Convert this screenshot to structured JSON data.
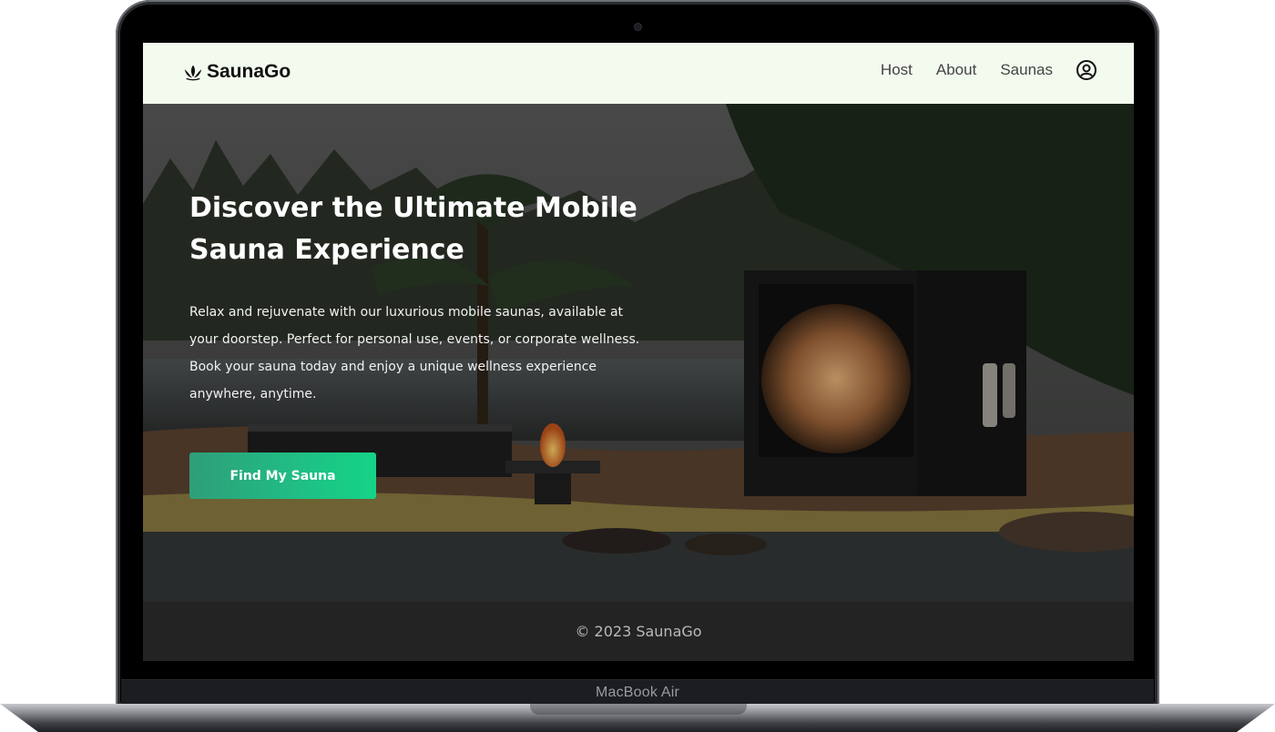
{
  "device": {
    "label": "MacBook Air"
  },
  "brand": {
    "name": "SaunaGo",
    "icon": "lotus-icon"
  },
  "nav": {
    "links": [
      "Host",
      "About",
      "Saunas"
    ],
    "account_icon": "user-circle-icon"
  },
  "hero": {
    "title": "Discover the Ultimate Mobile Sauna Experience",
    "description": "Relax and rejuvenate with our luxurious mobile saunas, available at your doorstep. Perfect for personal use, events, or corporate wellness. Book your sauna today and enjoy a unique wellness experience anywhere, anytime.",
    "cta_label": "Find My Sauna"
  },
  "footer": {
    "copyright": "© 2023 SaunaGo"
  },
  "colors": {
    "navbar_bg": "#f2fbee",
    "cta_start": "#2f9e79",
    "cta_end": "#14d487",
    "footer_bg": "#232323"
  }
}
